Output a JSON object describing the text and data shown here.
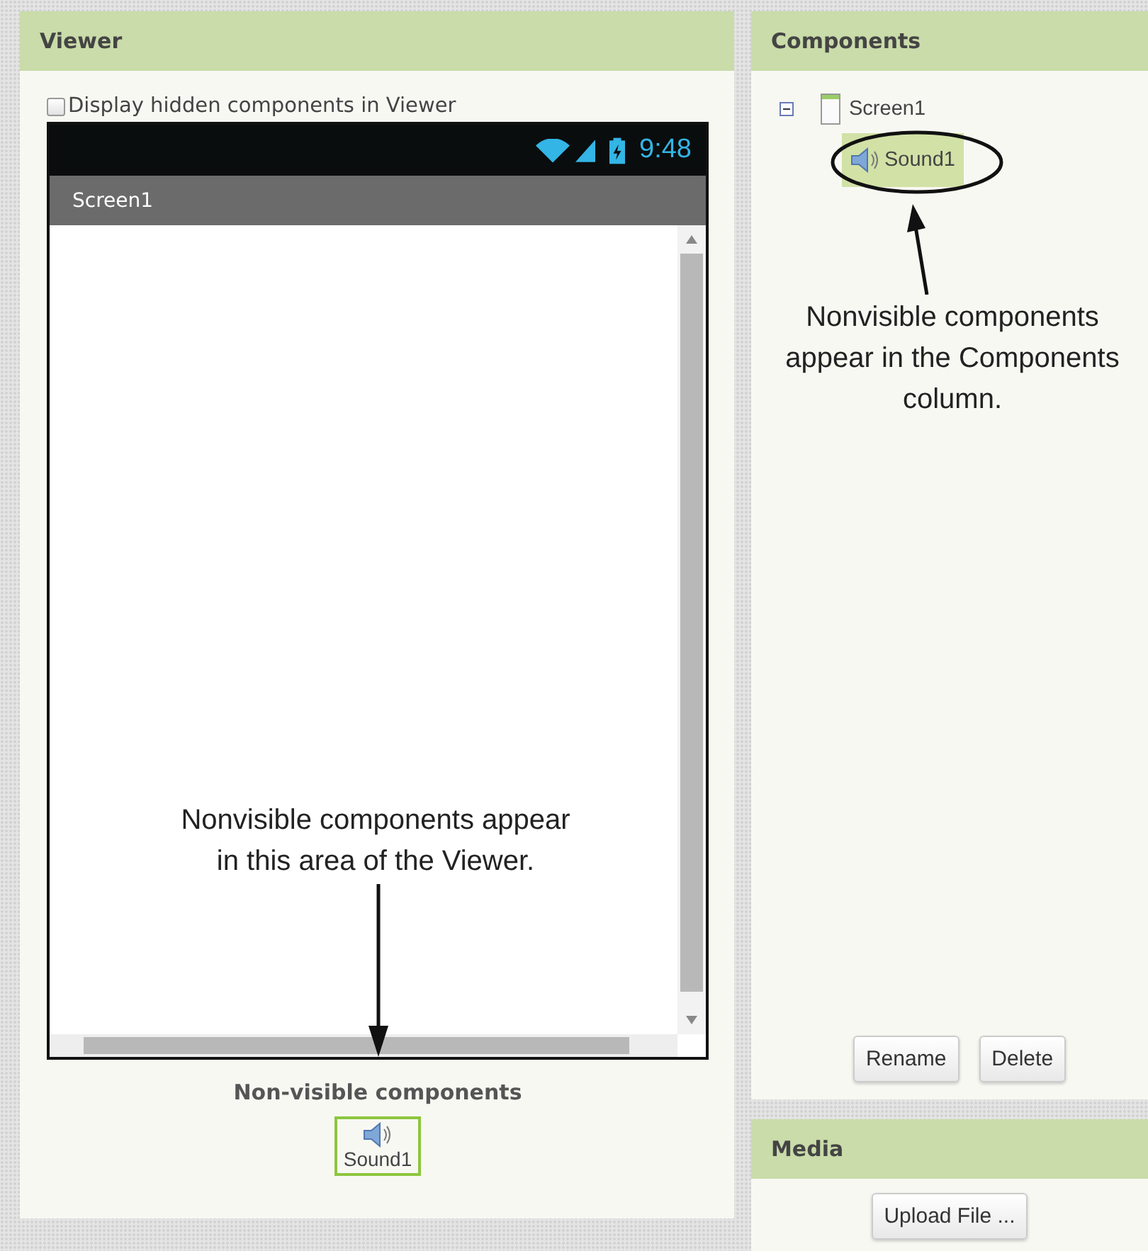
{
  "viewer": {
    "title": "Viewer",
    "hidden_checkbox": {
      "label": "Display hidden components in Viewer",
      "checked": false
    },
    "phone": {
      "time": "9:48",
      "screen_title": "Screen1"
    },
    "callout_lines": [
      "Nonvisible components appear",
      "in this area of the Viewer."
    ],
    "nonvisible": {
      "heading": "Non-visible components",
      "items": [
        {
          "label": "Sound1",
          "selected": true
        }
      ]
    }
  },
  "components": {
    "title": "Components",
    "tree": [
      {
        "label": "Screen1",
        "expanded": true,
        "selected": false,
        "children": [
          {
            "label": "Sound1",
            "selected": true
          }
        ]
      }
    ],
    "callout_lines": [
      "Nonvisible components",
      "appear in the Components",
      "column."
    ],
    "buttons": [
      "Rename",
      "Delete"
    ]
  },
  "media": {
    "title": "Media",
    "buttons": [
      "Upload File ..."
    ]
  }
}
